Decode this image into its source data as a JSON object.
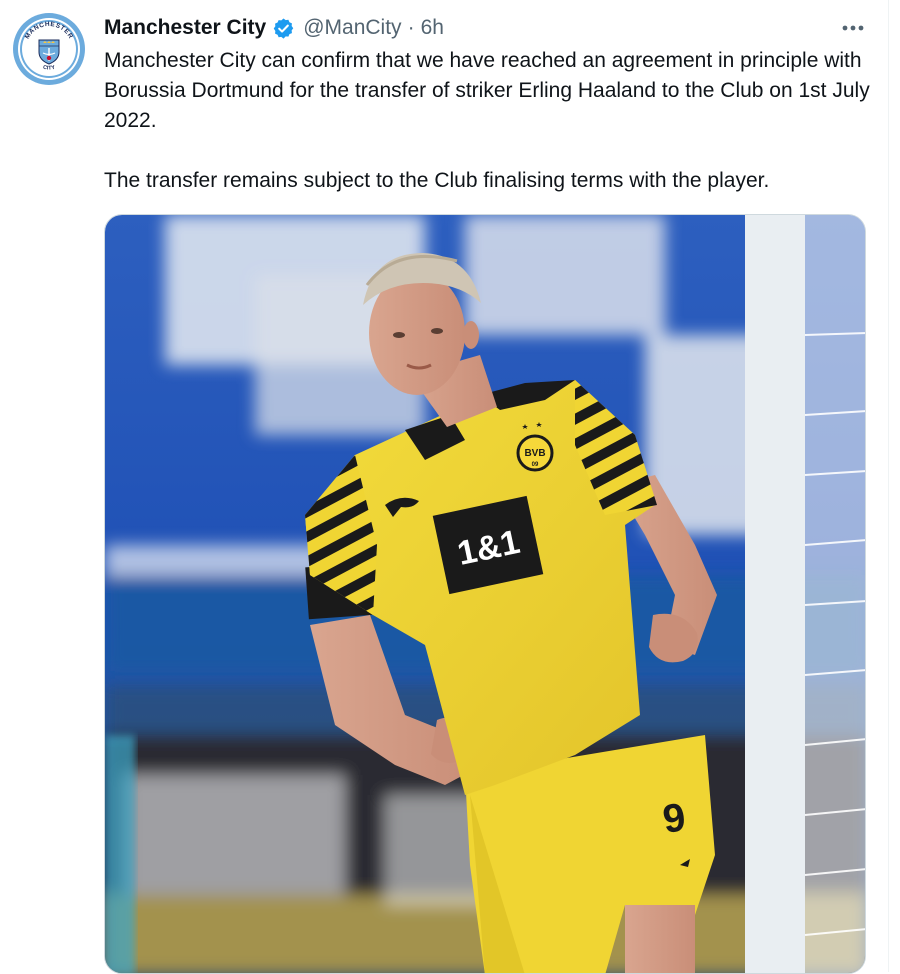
{
  "account": {
    "name": "Manchester City",
    "handle": "@ManCity",
    "separator": "·",
    "time": "6h",
    "avatar_icon": "manchester-city-crest-icon",
    "crest_top_text": "MANCHESTER",
    "crest_bottom_text": "CITY",
    "verified_icon": "verified-badge-icon"
  },
  "tweet": {
    "paragraphs": [
      "Manchester City can confirm that we have reached an agreement in principle with Borussia Dortmund for the transfer of striker Erling Haaland to the Club on 1st July 2022.",
      "The transfer remains subject to the Club finalising terms with the player."
    ]
  },
  "media": {
    "description_icon": "player-photo",
    "shirt_sponsor": "1&1",
    "crest_text": "BVB",
    "crest_sub": "09",
    "shirt_number": "9"
  },
  "colors": {
    "text": "#0f1419",
    "secondary": "#536471",
    "verified": "#1d9bf0",
    "city_blue": "#6cabdd",
    "dortmund_yellow": "#f2d730"
  },
  "menu": {
    "more_icon": "more-options-icon"
  }
}
